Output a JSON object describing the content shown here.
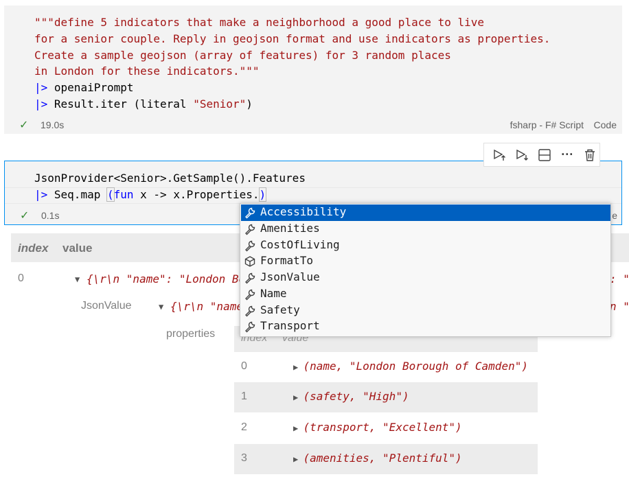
{
  "cell1": {
    "lines": [
      "\"\"\"define 5 indicators that make a neighborhood a good place to live",
      "for a senior couple. Reply in geojson format and use indicators as properties.",
      "Create a sample geojson (array of features) for 3 random places",
      "in London for these indicators.\"\"\""
    ],
    "pipe1_fn": "openaiPrompt",
    "pipe2_a": "Result.iter (literal ",
    "pipe2_str": "\"Senior\"",
    "pipe2_b": ")",
    "pipe_op": "|>",
    "status_time": "19.0s",
    "language": "fsharp - F# Script",
    "code_label": "Code"
  },
  "cell2": {
    "line1": "JsonProvider<Senior>.GetSample().Features",
    "line2_a": "Seq.map ",
    "line2_paren": "(",
    "line2_kw": "fun",
    "line2_b": " x -> x.Properties.",
    "line2_close": ")",
    "pipe_op": "|>",
    "status_time": "0.1s",
    "clipped_label": "e"
  },
  "autocomplete": {
    "items": [
      {
        "label": "Accessibility",
        "icon": "wrench-icon"
      },
      {
        "label": "Amenities",
        "icon": "wrench-icon"
      },
      {
        "label": "CostOfLiving",
        "icon": "wrench-icon"
      },
      {
        "label": "FormatTo",
        "icon": "cube-icon"
      },
      {
        "label": "JsonValue",
        "icon": "wrench-icon"
      },
      {
        "label": "Name",
        "icon": "wrench-icon"
      },
      {
        "label": "Safety",
        "icon": "wrench-icon"
      },
      {
        "label": "Transport",
        "icon": "wrench-icon"
      }
    ],
    "selected": "Accessibility"
  },
  "output": {
    "header_index": "index",
    "header_value": "value",
    "row0_index": "0",
    "row0_value": "{\\r\\n \"name\": \"London Bo",
    "row0_value_tail": ": \"",
    "jsonvalue_label": "JsonValue",
    "jsonvalue_value": "{\\r\\n \"name",
    "jsonvalue_tail": "n \"",
    "properties_label": "properties",
    "inner_header_index": "index",
    "inner_header_value": "value",
    "inner_rows": [
      {
        "index": "0",
        "value": "(name, \"London Borough of Camden\")"
      },
      {
        "index": "1",
        "value": "(safety, \"High\")"
      },
      {
        "index": "2",
        "value": "(transport, \"Excellent\")"
      },
      {
        "index": "3",
        "value": "(amenities, \"Plentiful\")"
      }
    ]
  },
  "toolbar": {
    "buttons": [
      "execute-above-icon",
      "execute-below-icon",
      "split-cell-icon",
      "more-icon",
      "trash-icon"
    ],
    "more_glyph": "···"
  },
  "colors": {
    "string": "#a31515",
    "keyword": "#0000ff",
    "selection": "#0060c0",
    "focus_border": "#0090f1",
    "success": "#388a34"
  }
}
